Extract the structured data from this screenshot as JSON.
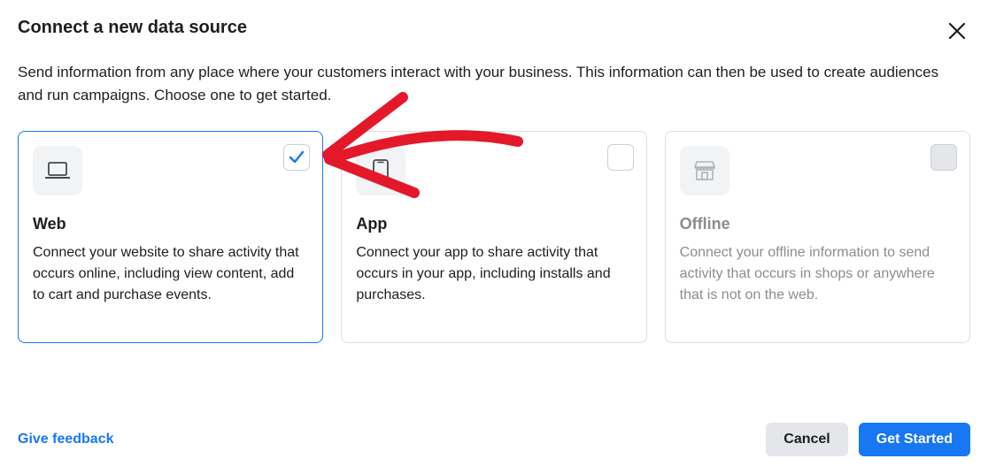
{
  "dialog": {
    "title": "Connect a new data source",
    "subtitle": "Send information from any place where your customers interact with your business. This information can then be used to create audiences and run campaigns. Choose one to get started."
  },
  "options": {
    "web": {
      "title": "Web",
      "description": "Connect your website to share activity that occurs online, including view content, add to cart and purchase events.",
      "selected": true
    },
    "app": {
      "title": "App",
      "description": "Connect your app to share activity that occurs in your app, including installs and purchases.",
      "selected": false
    },
    "offline": {
      "title": "Offline",
      "description": "Connect your offline information to send activity that occurs in shops or anywhere that is not on the web.",
      "selected": false,
      "disabled": true
    }
  },
  "footer": {
    "feedback_label": "Give feedback",
    "cancel_label": "Cancel",
    "get_started_label": "Get Started"
  }
}
